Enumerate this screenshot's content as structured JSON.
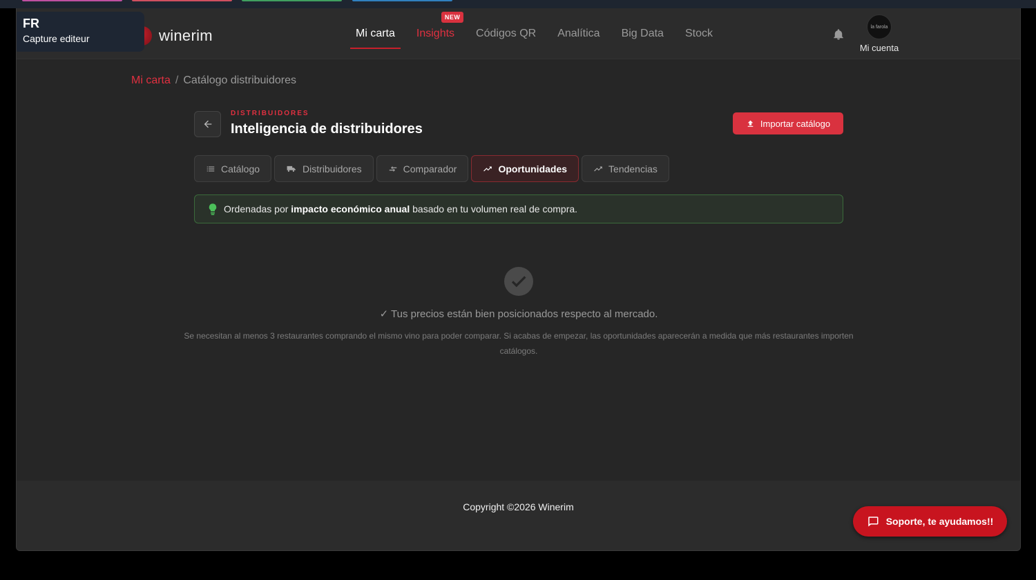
{
  "overlay": {
    "lang": "FR",
    "subtitle": "Capture editeur"
  },
  "brand": {
    "name": "winerim",
    "accent": "#d9323f"
  },
  "nav": {
    "items": [
      {
        "label": "Mi carta",
        "state": "active"
      },
      {
        "label": "Insights",
        "state": "highlight",
        "badge": "NEW"
      },
      {
        "label": "Códigos QR",
        "state": "normal"
      },
      {
        "label": "Analítica",
        "state": "normal"
      },
      {
        "label": "Big Data",
        "state": "normal"
      },
      {
        "label": "Stock",
        "state": "normal"
      }
    ],
    "account_label": "Mi cuenta",
    "avatar_text": "la farola"
  },
  "breadcrumb": {
    "root": "Mi carta",
    "separator": "/",
    "current": "Catálogo distribuidores"
  },
  "header": {
    "eyebrow": "DISTRIBUIDORES",
    "title": "Inteligencia de distribuidores",
    "import_label": "Importar catálogo"
  },
  "tabs": [
    {
      "label": "Catálogo",
      "icon": "list-icon"
    },
    {
      "label": "Distribuidores",
      "icon": "truck-icon"
    },
    {
      "label": "Comparador",
      "icon": "compare-icon"
    },
    {
      "label": "Oportunidades",
      "icon": "trend-up-icon",
      "active": true
    },
    {
      "label": "Tendencias",
      "icon": "trend-icon"
    }
  ],
  "info": {
    "prefix": "Ordenadas por ",
    "bold": "impacto económico anual",
    "suffix": " basado en tu volumen real de compra."
  },
  "empty_state": {
    "message": "✓ Tus precios están bien posicionados respecto al mercado.",
    "note": "Se necesitan al menos 3 restaurantes comprando el mismo vino para poder comparar. Si acabas de empezar, las oportunidades aparecerán a medida que más restaurantes importen catálogos."
  },
  "footer": {
    "copyright": "Copyright ©2026 Winerim"
  },
  "support": {
    "label": "Soporte, te ayudamos!!"
  }
}
